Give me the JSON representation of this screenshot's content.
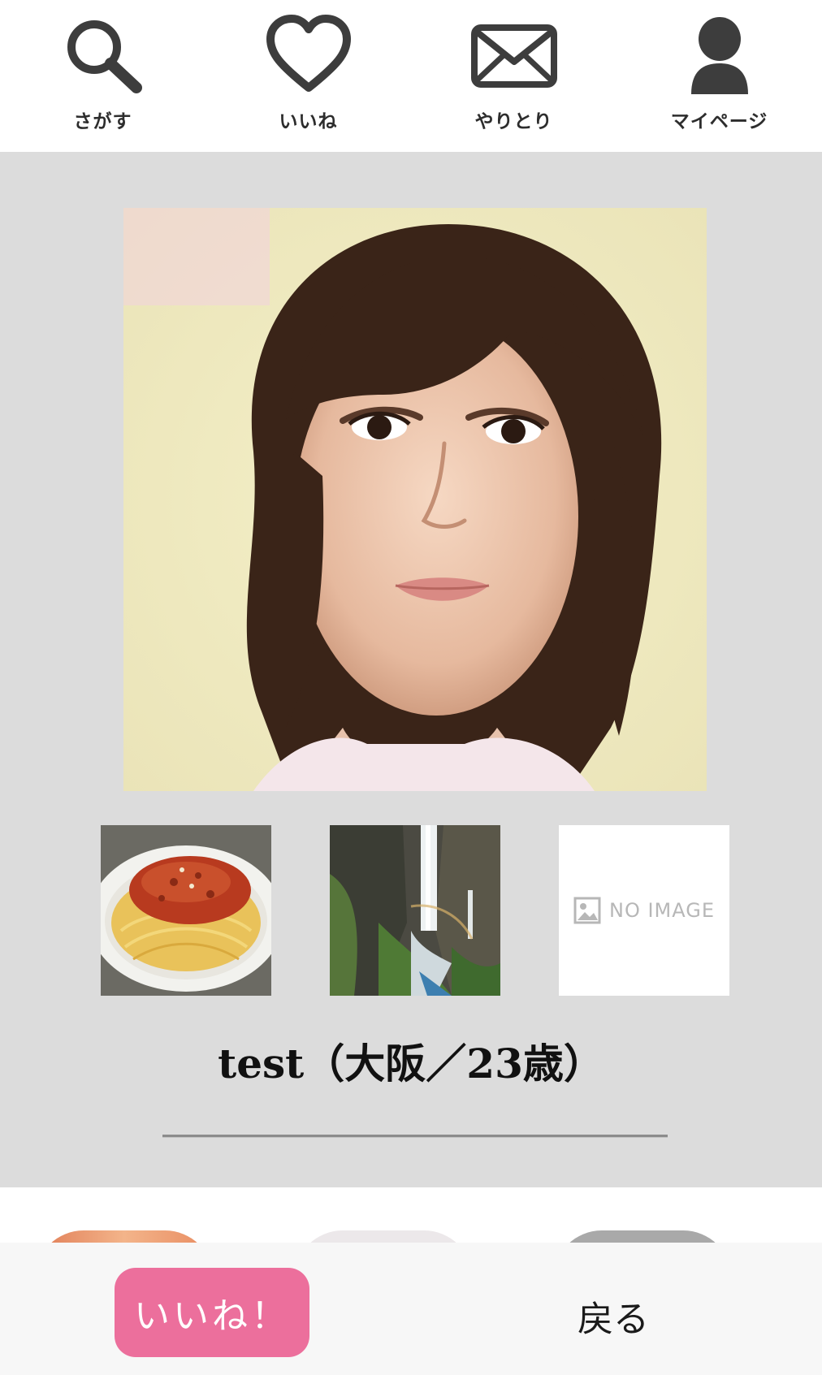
{
  "nav": {
    "items": [
      {
        "label": "さがす",
        "icon": "search-icon"
      },
      {
        "label": "いいね",
        "icon": "heart-icon"
      },
      {
        "label": "やりとり",
        "icon": "mail-icon"
      },
      {
        "label": "マイページ",
        "icon": "user-icon"
      }
    ]
  },
  "profile": {
    "name": "test（大阪／23歳）",
    "main_photo": "portrait-photo",
    "thumbnails": [
      {
        "type": "photo",
        "subject": "spaghetti-bolognese"
      },
      {
        "type": "photo",
        "subject": "waterfall"
      },
      {
        "type": "placeholder",
        "text": "NO IMAGE"
      }
    ]
  },
  "bottom_bar": {
    "like_label": "いいね！",
    "back_label": "戻る"
  },
  "colors": {
    "like_button": "#ec6f9c",
    "profile_background": "#dcdcdc",
    "nav_icon": "#3d3d3d"
  }
}
